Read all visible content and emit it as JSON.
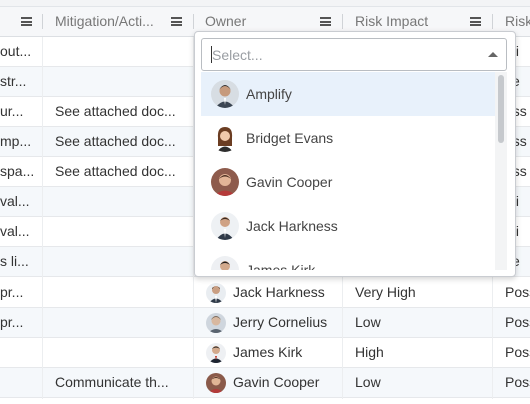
{
  "header": {
    "col_mitigation": "Mitigation/Acti...",
    "col_owner": "Owner",
    "col_risk_impact": "Risk Impact",
    "col_risk_next": "Risk"
  },
  "rows": [
    {
      "c1": "out...",
      "c2": "",
      "c5": "nli"
    },
    {
      "c1": "str...",
      "c2": "",
      "c5": "ke"
    },
    {
      "c1": "ur...",
      "c2": "See attached doc...",
      "c5": "oss"
    },
    {
      "c1": "mp...",
      "c2": "See attached doc...",
      "c5": "oss"
    },
    {
      "c1": "spa...",
      "c2": "See attached doc...",
      "c5": "oss"
    },
    {
      "c1": "val...",
      "c2": "",
      "c5": "nli"
    },
    {
      "c1": "val...",
      "c2": "",
      "c5": "nli"
    },
    {
      "c1": "s li...",
      "c2": "",
      "c5": "ke"
    },
    {
      "c1": "pr...",
      "c2": "",
      "owner": "Jack Harkness",
      "impact": "Very High",
      "c5": "Poss"
    },
    {
      "c1": "pr...",
      "c2": "",
      "owner": "Jerry Cornelius",
      "impact": "Low",
      "c5": "Poss"
    },
    {
      "c1": "",
      "c2": "",
      "owner": "James Kirk",
      "impact": "High",
      "c5": "Poss"
    },
    {
      "c1": "",
      "c2": "Communicate th...",
      "owner": "Gavin Cooper",
      "impact": "Low",
      "c5": "Poss"
    }
  ],
  "dropdown": {
    "placeholder": "Select...",
    "options": [
      "Amplify",
      "Bridget Evans",
      "Gavin Cooper",
      "Jack Harkness",
      "James Kirk"
    ],
    "highlighted_index": 0
  },
  "colors": {
    "row_alt": "#f5f8fb",
    "highlight": "#e8f1fb",
    "header_bg": "#f6f7f9"
  }
}
